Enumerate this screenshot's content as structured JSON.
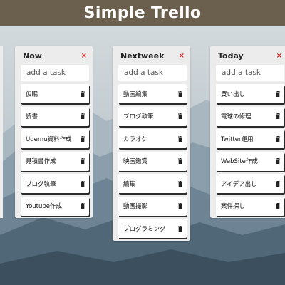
{
  "app": {
    "title": "Simple Trello"
  },
  "lists": [
    {
      "title": "Now",
      "close_icon": "×",
      "input_placeholder": "add a task",
      "cards": [
        "仮眠",
        "読書",
        "Udemu資料作成",
        "見積書作成",
        "ブログ執筆",
        "Youtube作成"
      ]
    },
    {
      "title": "Nextweek",
      "close_icon": "×",
      "input_placeholder": "add a task",
      "cards": [
        "動画編集",
        "ブログ執筆",
        "カラオケ",
        "映画鑑賞",
        "編集",
        "動画撮影",
        "プログラミング"
      ]
    },
    {
      "title": "Today",
      "close_icon": "×",
      "input_placeholder": "add a task",
      "cards": [
        "買い出し",
        "電球の修理",
        "Twitter運用",
        "WebSite作成",
        "アイデア出し",
        "案件探し"
      ]
    }
  ],
  "colors": {
    "header_bg": "#6b5f4d",
    "list_bg": "#ececec",
    "close_icon": "#d0201a"
  },
  "icons": {
    "card_action": "trash-icon",
    "list_close": "close-icon"
  }
}
